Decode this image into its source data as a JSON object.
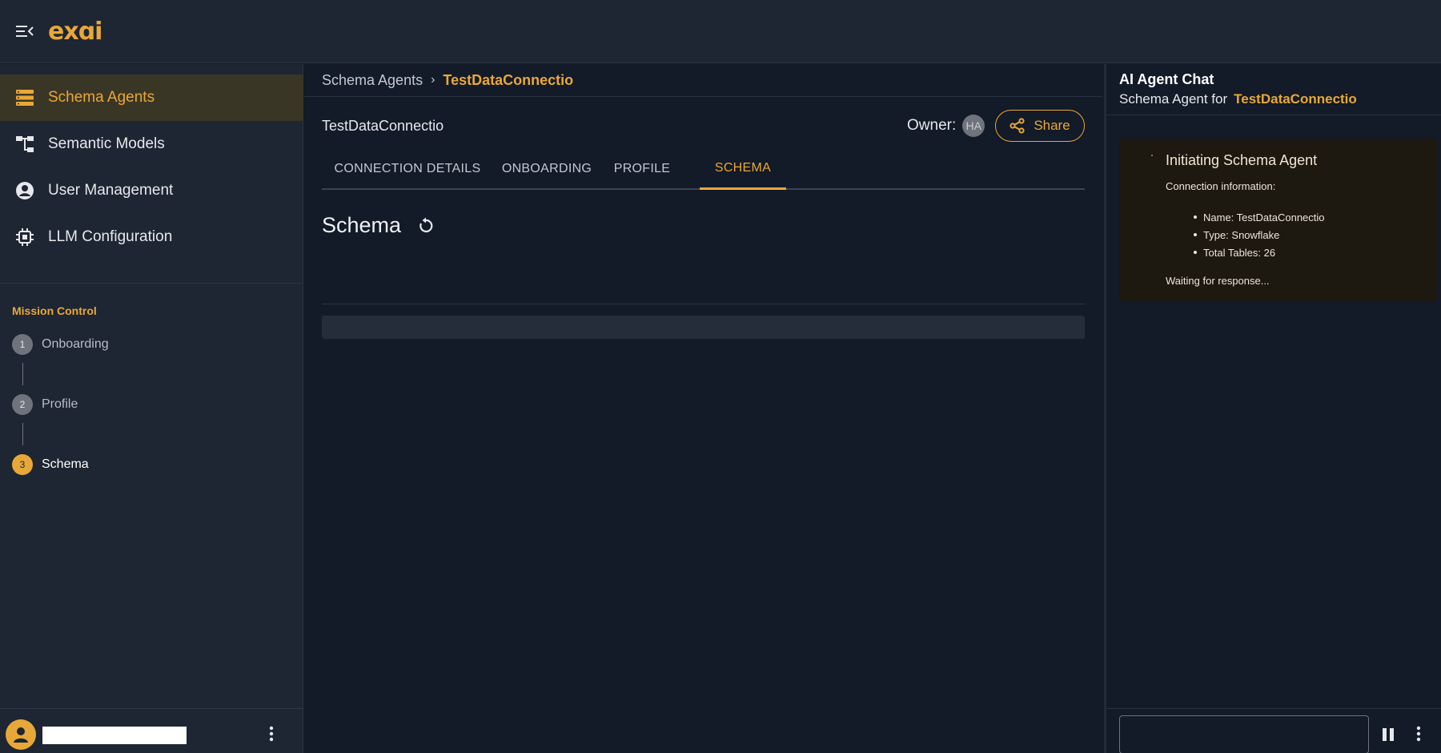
{
  "app": {
    "logo_text": "exɑi",
    "accent_color": "#e8a838"
  },
  "sidebar": {
    "items": [
      {
        "label": "Schema Agents",
        "icon": "list-icon",
        "active": true
      },
      {
        "label": "Semantic Models",
        "icon": "hierarchy-icon",
        "active": false
      },
      {
        "label": "User Management",
        "icon": "account-circle-icon",
        "active": false
      },
      {
        "label": "LLM Configuration",
        "icon": "chip-icon",
        "active": false
      }
    ],
    "mission_control": {
      "title": "Mission Control",
      "steps": [
        {
          "number": "1",
          "label": "Onboarding"
        },
        {
          "number": "2",
          "label": "Profile"
        },
        {
          "number": "3",
          "label": "Schema"
        }
      ]
    }
  },
  "main": {
    "breadcrumb": {
      "root": "Schema Agents",
      "separator": "›",
      "current": "TestDataConnectio"
    },
    "connection_title": "TestDataConnectio",
    "owner_label": "Owner:",
    "owner_initials": "HA",
    "share_label": "Share",
    "tabs": [
      {
        "label": "CONNECTION DETAILS"
      },
      {
        "label": "ONBOARDING"
      },
      {
        "label": "PROFILE"
      },
      {
        "label": "SCHEMA"
      }
    ],
    "section_heading": "Schema"
  },
  "chat": {
    "title": "AI Agent Chat",
    "subtitle_prefix": "Schema Agent for",
    "subtitle_highlight": "TestDataConnectio",
    "message": {
      "title": "Initiating Schema Agent",
      "label": "Connection information:",
      "items": [
        "Name: TestDataConnectio",
        "Type: Snowflake",
        "Total Tables: 26"
      ],
      "status": "Waiting for response..."
    },
    "input_value": ""
  }
}
